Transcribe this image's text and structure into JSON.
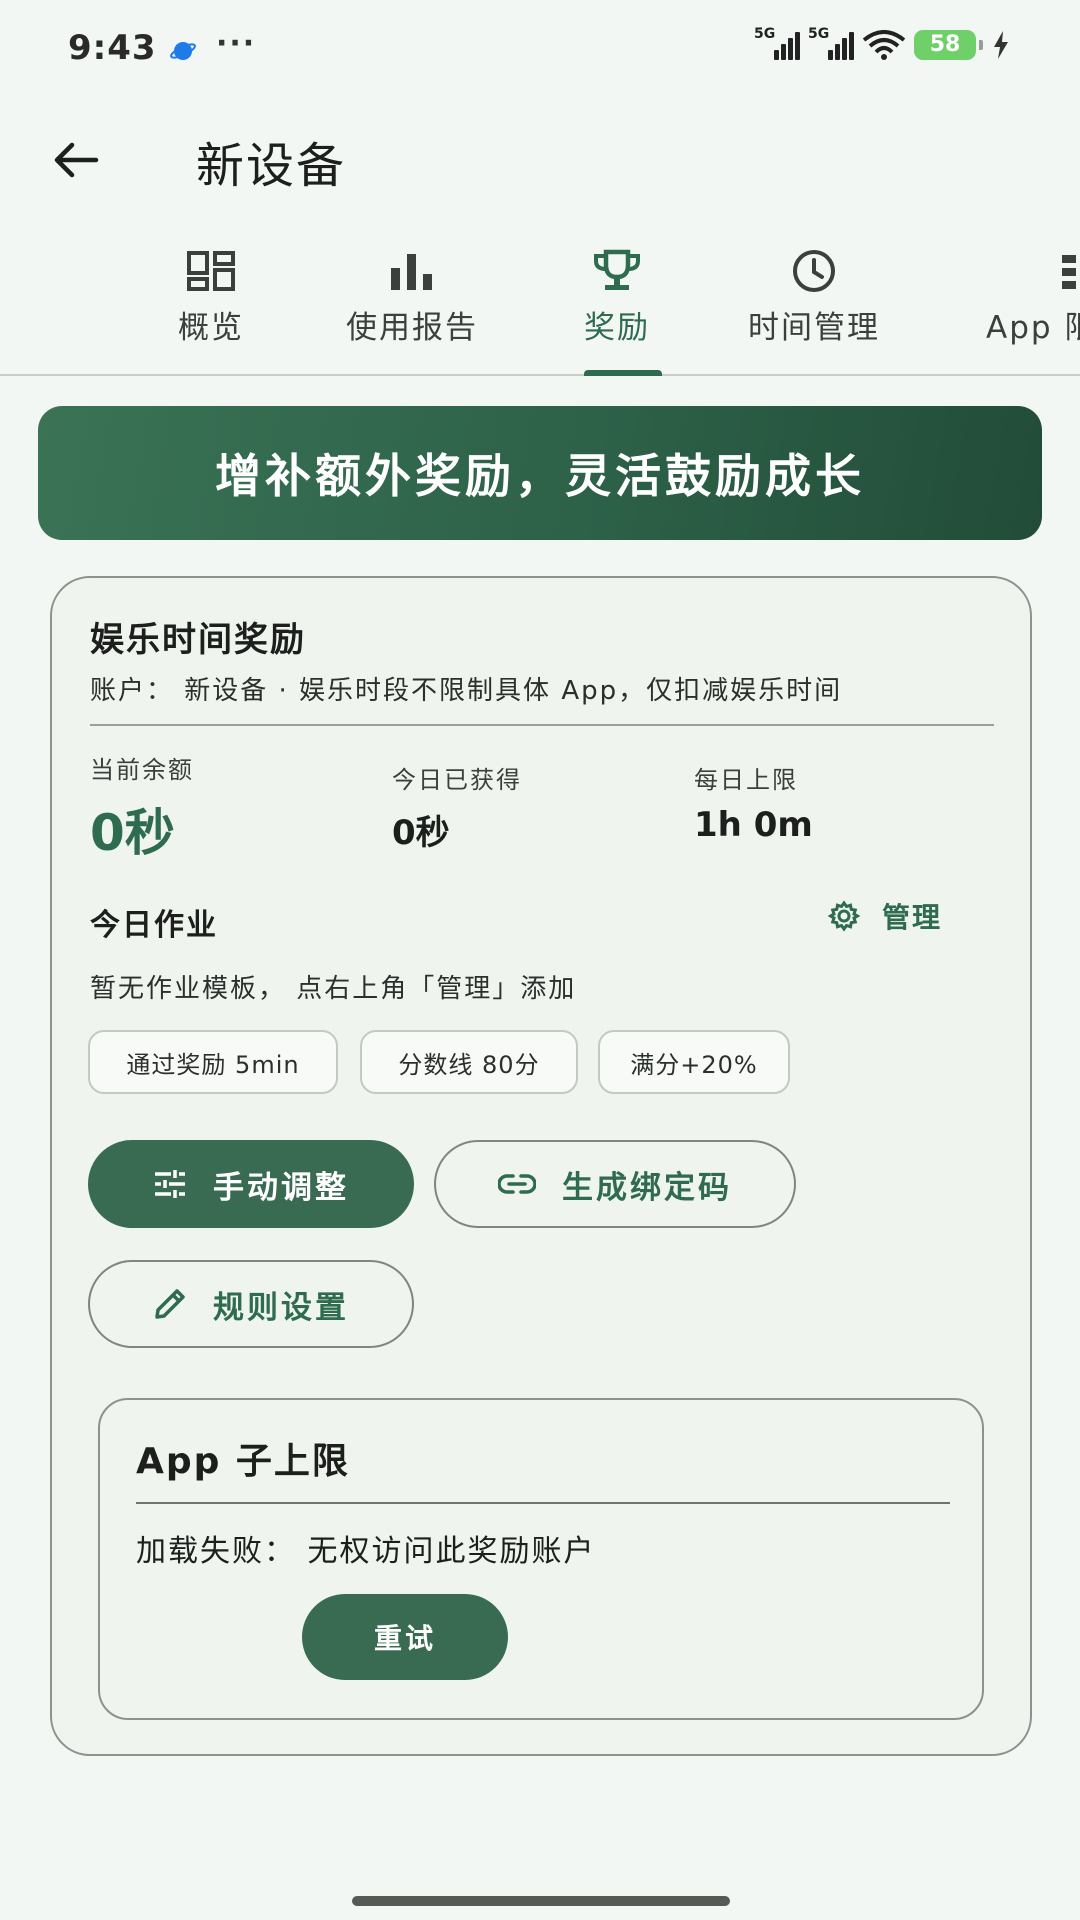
{
  "status_bar": {
    "time": "9:43",
    "dots": "···",
    "network_1": "5G",
    "network_2": "5G",
    "battery": "58",
    "icons": [
      "planet-icon",
      "signal-icon",
      "wifi-icon",
      "battery-icon",
      "charging-icon"
    ]
  },
  "app_bar": {
    "title": "新设备",
    "back_icon": "arrow-left-icon"
  },
  "tabs": [
    {
      "label": "概览",
      "icon": "dashboard-icon"
    },
    {
      "label": "使用报告",
      "icon": "bar-chart-icon"
    },
    {
      "label": "奖励",
      "icon": "trophy-icon",
      "active": true
    },
    {
      "label": "时间管理",
      "icon": "clock-icon"
    },
    {
      "label": "App 限",
      "icon": "list-icon"
    }
  ],
  "banner": {
    "text": "增补额外奖励，灵活鼓励成长"
  },
  "reward_card": {
    "title": "娱乐时间奖励",
    "subtitle": "账户： 新设备 · 娱乐时段不限制具体 App，仅扣减娱乐时间",
    "stats": {
      "balance_label": "当前余额",
      "balance_value": "0秒",
      "earned_label": "今日已获得",
      "earned_value": "0秒",
      "limit_label": "每日上限",
      "limit_value": "1h 0m"
    },
    "homework": {
      "title": "今日作业",
      "manage_label": "管理",
      "empty_text": "暂无作业模板， 点右上角「管理」添加",
      "chips": [
        "通过奖励 5min",
        "分数线 80分",
        "满分+20%"
      ]
    },
    "buttons": {
      "manual_adjust": "手动调整",
      "bind_code": "生成绑定码",
      "rule_settings": "规则设置"
    },
    "app_sub_limit": {
      "title": "App 子上限",
      "error": "加载失败： 无权访问此奖励账户",
      "retry": "重试"
    }
  },
  "colors": {
    "accent": "#2f6b4f",
    "button_fill": "#386b52",
    "background": "#f3f7f3",
    "battery": "#6fd06a"
  }
}
